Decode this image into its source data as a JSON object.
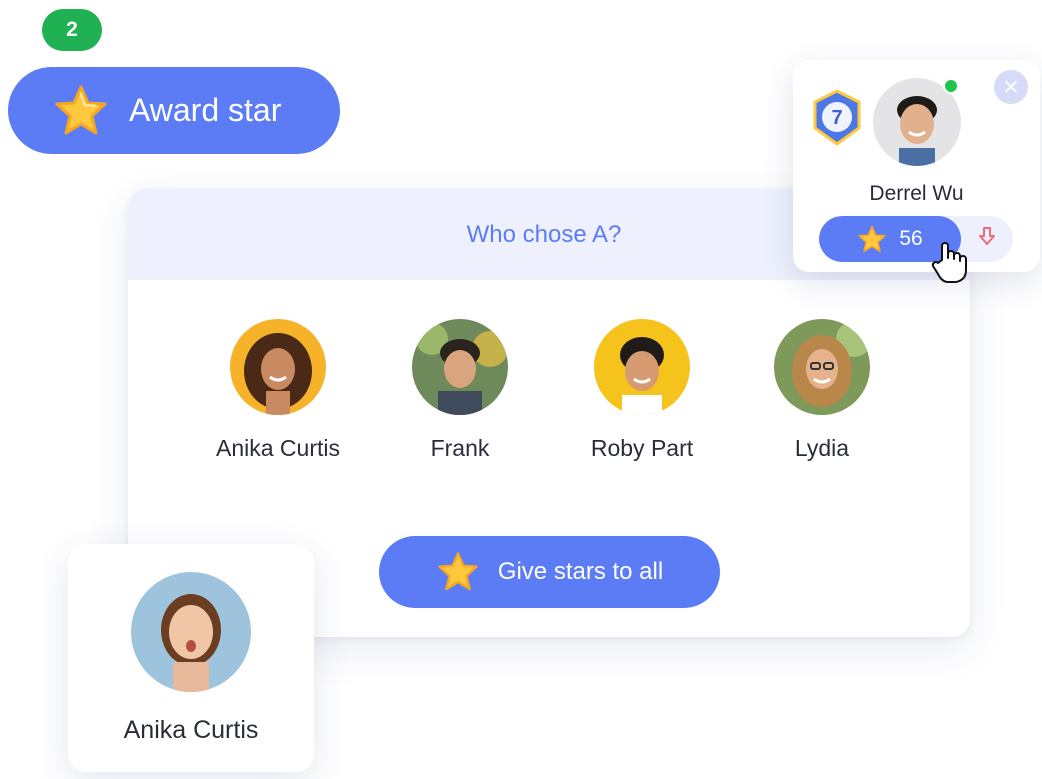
{
  "step": {
    "number": "2",
    "color": "#1fb152"
  },
  "award": {
    "label": "Award star",
    "icon": "star-icon"
  },
  "modal": {
    "title": "Who chose A?",
    "students": [
      {
        "name": "Anika Curtis",
        "avatar": "avatar-anika"
      },
      {
        "name": "Frank",
        "avatar": "avatar-frank"
      },
      {
        "name": "Roby Part",
        "avatar": "avatar-roby"
      },
      {
        "name": "Lydia",
        "avatar": "avatar-lydia"
      }
    ],
    "give_all_label": "Give stars to all"
  },
  "selected_card": {
    "name": "Anika Curtis"
  },
  "profile": {
    "name": "Derrel Wu",
    "level": "7",
    "stars": "56",
    "online": true,
    "online_color": "#1fc54a"
  },
  "colors": {
    "accent": "#5b7cf5",
    "header_bg": "#eef1fd",
    "star_gold": "#ffc83d",
    "minus_red": "#f06a7a"
  }
}
